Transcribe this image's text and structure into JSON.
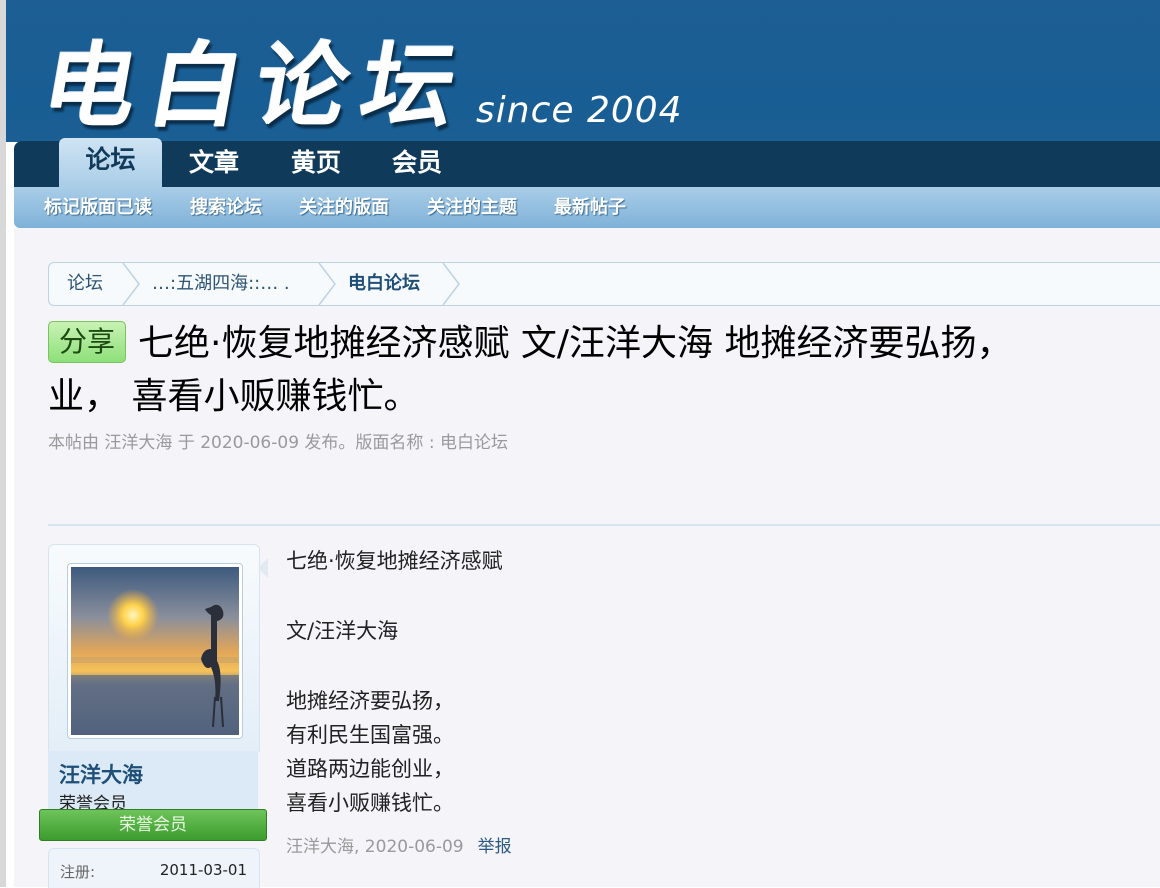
{
  "header": {
    "logo_text": "电白论坛",
    "since_text": "since 2004"
  },
  "nav": {
    "tabs": [
      {
        "label": "论坛",
        "active": true
      },
      {
        "label": "文章",
        "active": false
      },
      {
        "label": "黄页",
        "active": false
      },
      {
        "label": "会员",
        "active": false
      }
    ]
  },
  "subnav": {
    "items": [
      "标记版面已读",
      "搜索论坛",
      "关注的版面",
      "关注的主题",
      "最新帖子"
    ]
  },
  "breadcrumb": {
    "items": [
      "论坛",
      "…:五湖四海::… .",
      "电白论坛"
    ]
  },
  "thread": {
    "prefix": "分享",
    "title_line1": "七绝·恢复地摊经济感赋 文/汪洋大海 地摊经济要弘扬，",
    "title_line2": "业， 喜看小贩赚钱忙。",
    "meta": "本帖由 汪洋大海 于 2020-06-09 发布。版面名称 : 电白论坛"
  },
  "post": {
    "author": {
      "name": "汪洋大海",
      "title": "荣誉会员",
      "badge": "荣誉会员",
      "register_label": "注册:",
      "register_date": "2011-03-01"
    },
    "body": {
      "line1": "七绝·恢复地摊经济感赋",
      "line2": "文/汪洋大海",
      "line3": "地摊经济要弘扬，",
      "line4": "有利民生国富强。",
      "line5": "道路两边能创业，",
      "line6": "喜看小贩赚钱忙。"
    },
    "footer": {
      "author_date": "汪洋大海, 2020-06-09",
      "report": "举报"
    }
  },
  "colors": {
    "header_bg": "#1b5f94",
    "nav_bg": "#0f3a5a",
    "subnav_bg": "#8fbde0",
    "prefix_bg": "#a8e894",
    "badge_bg": "#4fae3e"
  }
}
